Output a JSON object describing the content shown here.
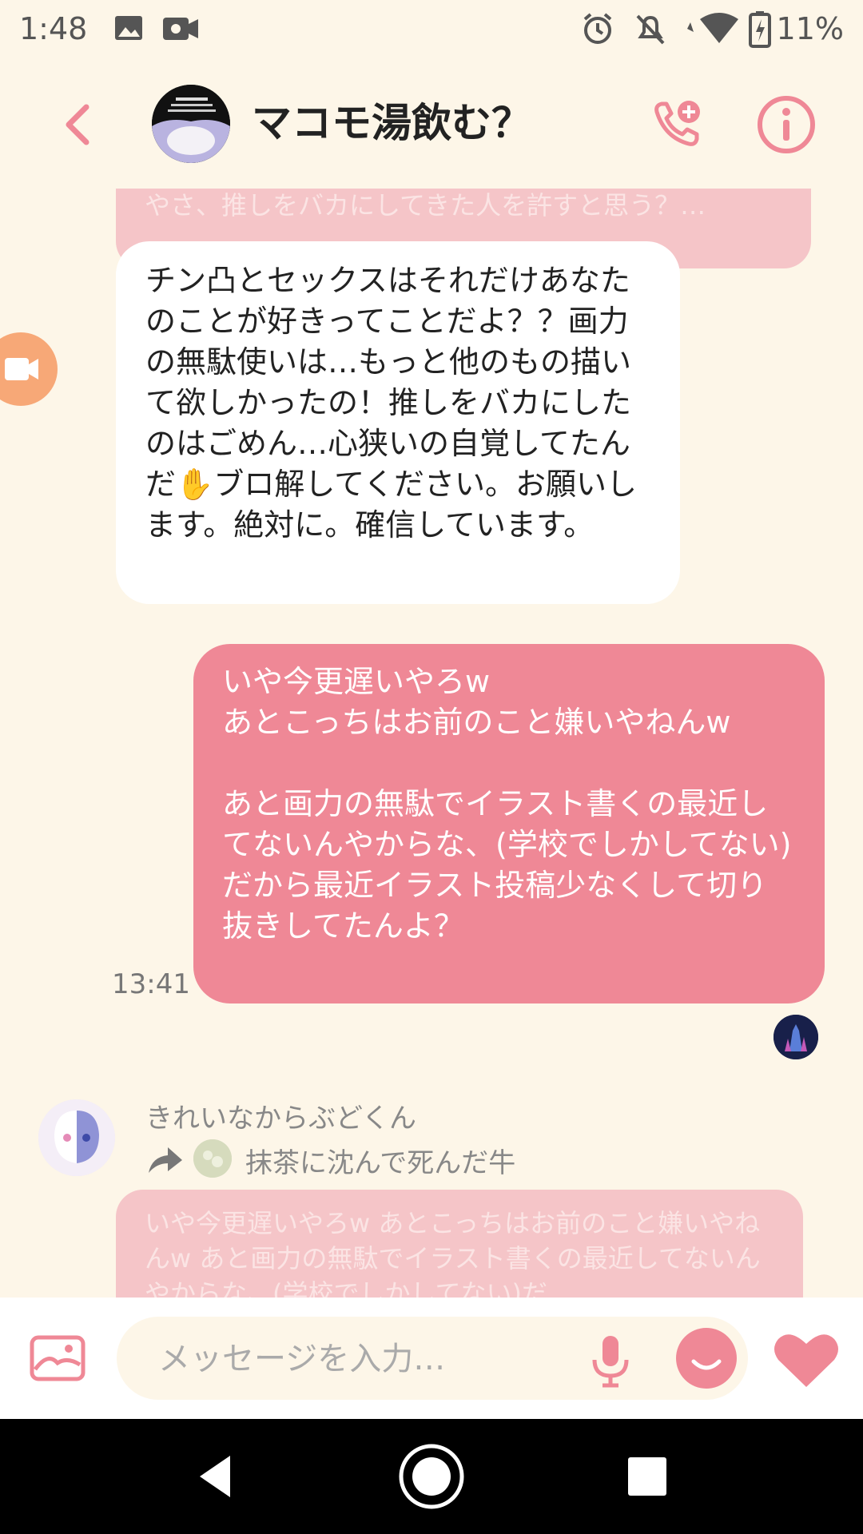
{
  "status_bar": {
    "time": "1:48",
    "battery": "11%",
    "icons": [
      "image-icon",
      "video-icon",
      "alarm-icon",
      "notifications-off-icon",
      "wifi-icon",
      "battery-charging-icon"
    ]
  },
  "header": {
    "title": "マコモ湯飲む？",
    "back_icon": "back-chevron-icon",
    "call_icon": "add-call-icon",
    "info_icon": "info-icon"
  },
  "messages": {
    "faded_reply_top": "やさ、推しをバカにしてきた人を許すと思う？…",
    "incoming_text": "チン凸とセックスはそれだけあなたのことが好きってことだよ？？画力の無駄使いは…もっと他のもの描いて欲しかったの！推しをバカにしたのはごめん…心狭いの自覚してたんだ✋ブロ解してください。お願いします。絶対に。確信しています。",
    "outgoing_text": "いや今更遅いやろw\nあとこっちはお前のこと嫌いやねんw\n\nあと画力の無駄でイラスト書くの最近してないんやからな、(学校でしかしてない)\nだから最近イラスト投稿少なくして切り抜きしてたんよ？",
    "outgoing_time": "13:41",
    "sender_name": "きれいなからぶどくん",
    "forwarded_from": "抹茶に沈んで死んだ牛",
    "faded_forward_text": "いや今更遅いやろw あとこっちはお前のこと嫌いやねんw あと画力の無駄でイラスト書くの最近してないんやからな、(学校でしかしてない)だ"
  },
  "input": {
    "placeholder": "メッセージを入力…"
  },
  "colors": {
    "background": "#fdf6e8",
    "accent": "#ef8896",
    "fab": "#f7a877"
  }
}
